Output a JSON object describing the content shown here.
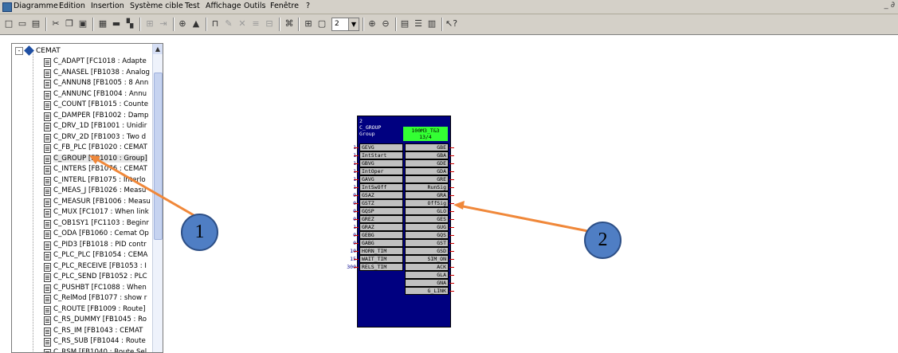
{
  "menubar": {
    "items": [
      "Diagramme",
      "Edition",
      "Insertion",
      "Système cible",
      "Test",
      "Affichage",
      "Outils",
      "Fenêtre",
      "?"
    ],
    "right_controls": "_ ∂"
  },
  "toolbar": {
    "zoom_value": "2"
  },
  "tree": {
    "root_label": "CEMAT",
    "root_expander": "-",
    "items": [
      "C_ADAPT [FC1018 : Adapte",
      "C_ANASEL [FB1038 : Analog",
      "C_ANNUN8 [FB1005 : 8 Ann",
      "C_ANNUNC [FB1004 : Annu",
      "C_COUNT [FB1015 : Counte",
      "C_DAMPER [FB1002 : Damp",
      "C_DRV_1D [FB1001 : Unidir",
      "C_DRV_2D [FB1003 : Two d",
      "C_FB_PLC [FB1020 : CEMAT",
      "C_GROUP [FB1010 : Group]",
      "C_INTERS [FB1076 : CEMAT",
      "C_INTERL [FB1075 : Interlo",
      "C_MEAS_J [FB1026 : Measu",
      "C_MEASUR [FB1006 : Measu",
      "C_MUX [FC1017 : When link",
      "C_OB1SY1 [FC1103 : Beginr",
      "C_ODA [FB1060 : Cemat Op",
      "C_PID3 [FB1018 : PID contr",
      "C_PLC_PLC [FB1054 : CEMA",
      "C_PLC_RECEIVE [FB1053 : I",
      "C_PLC_SEND [FB1052 : PLC",
      "C_PUSHBT [FC1088 : When",
      "C_RelMod [FB1077 : show r",
      "C_ROUTE [FB1009 : Route]",
      "C_RS_DUMMY [FB1045 : Ro",
      "C_RS_IM [FB1043 : CEMAT",
      "C_RS_SUB [FB1044 : Route",
      "C_RSM [FB1040 : Route Sel"
    ]
  },
  "function_block": {
    "number": "2",
    "type_name": "C_GROUP",
    "comment": "Group",
    "instance_name": "100M3_T&3",
    "instance_sub": "13/4",
    "inputs": [
      {
        "name": "GEVG",
        "value": "1"
      },
      {
        "name": "IntStart",
        "value": "1"
      },
      {
        "name": "GBVG",
        "value": "1"
      },
      {
        "name": "IntOper",
        "value": "1"
      },
      {
        "name": "GAVG",
        "value": "1"
      },
      {
        "name": "IntSwOff",
        "value": "1"
      },
      {
        "name": "GSAZ",
        "value": "0"
      },
      {
        "name": "GSTZ",
        "value": "0"
      },
      {
        "name": "GQSP",
        "value": "0"
      },
      {
        "name": "GREZ",
        "value": "0"
      },
      {
        "name": "GRAZ",
        "value": "1"
      },
      {
        "name": "GEBG",
        "value": "0"
      },
      {
        "name": "GABG",
        "value": "0"
      },
      {
        "name": "HORN_TIM",
        "value": "10"
      },
      {
        "name": "WAIT_TIM",
        "value": "15"
      },
      {
        "name": "RELS_TIM",
        "value": "300"
      }
    ],
    "outputs": [
      "GBE",
      "GBA",
      "GDE",
      "GDA",
      "GRE",
      "RunSig",
      "GRA",
      "OffSig",
      "GLO",
      "GES",
      "GUG",
      "GQS",
      "GST",
      "GSD",
      "SIM_ON",
      "ACK",
      "GLA",
      "GNA",
      "G_LINK"
    ]
  },
  "callouts": {
    "first": "1",
    "second": "2"
  },
  "colors": {
    "block_body": "#000080",
    "instance_bg": "#33ff33",
    "callout_fill": "#4f7ec4",
    "arrow": "#f0883a"
  }
}
